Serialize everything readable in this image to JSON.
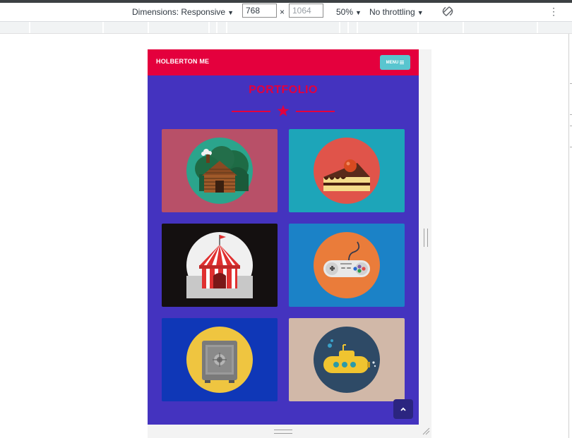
{
  "devtools": {
    "dimensions_label": "Dimensions: Responsive",
    "width_value": "768",
    "height_placeholder": "1064",
    "times_sign": "×",
    "zoom": "50%",
    "throttling": "No throttling",
    "icons": [
      "rotate-icon",
      "kebab-menu-icon",
      "dropdown-arrow-icon"
    ]
  },
  "site": {
    "brand": "HOLBERTON ME",
    "menu_label": "MENU",
    "menu_icon": "hamburger-icon",
    "section_title": "PORTFOLIO",
    "divider_icon": "star-icon",
    "back_to_top_icon": "chevron-up-icon",
    "colors": {
      "primary": "#e4003d",
      "background": "#4433bf",
      "accent": "#59c5cf"
    },
    "portfolio": [
      {
        "icon": "cabin-icon",
        "color": "#b85068"
      },
      {
        "icon": "cake-icon",
        "color": "#1da5b9"
      },
      {
        "icon": "circus-tent-icon",
        "color": "#141010"
      },
      {
        "icon": "game-controller-icon",
        "color": "#1b82c7"
      },
      {
        "icon": "safe-icon",
        "color": "#0f37b7"
      },
      {
        "icon": "submarine-icon",
        "color": "#d1b8a8"
      }
    ]
  }
}
